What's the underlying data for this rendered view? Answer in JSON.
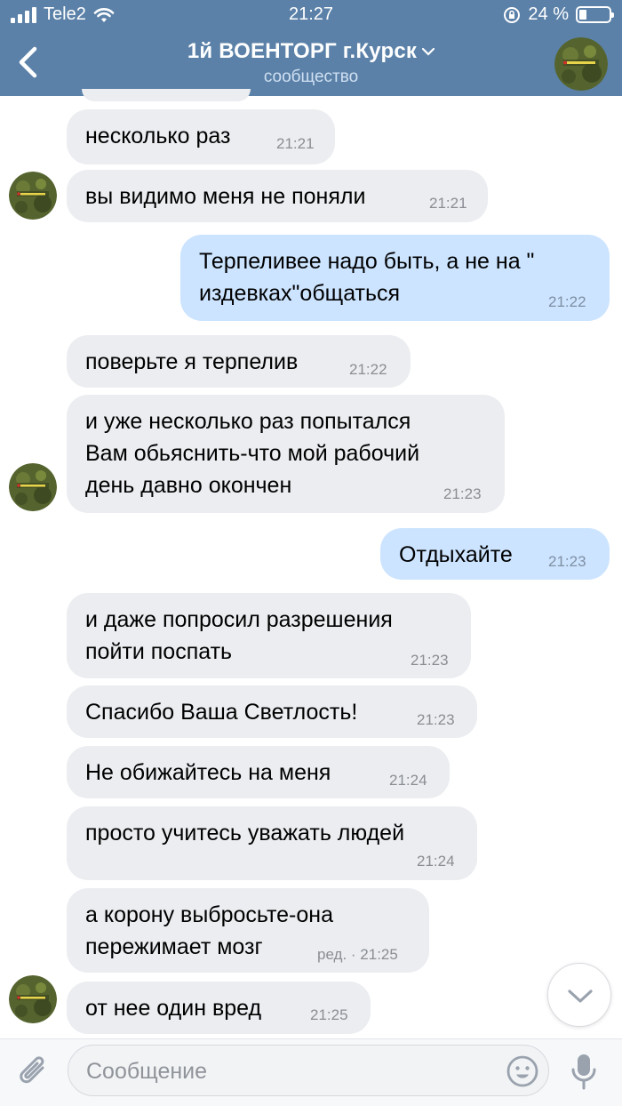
{
  "status_bar": {
    "carrier": "Tele2",
    "time": "21:27",
    "battery_text": "24 %",
    "battery_level": 0.24
  },
  "header": {
    "title": "1й ВОЕНТОРГ г.Курск",
    "subtitle": "сообщество"
  },
  "messages": [
    {
      "text": "несколько раз",
      "time": "21:21"
    },
    {
      "text": "вы видимо меня не поняли",
      "time": "21:21"
    },
    {
      "text": "Терпеливее надо быть, а не на \"\nиздевках\"общаться",
      "time": "21:22"
    },
    {
      "text": "поверьте я терпелив",
      "time": "21:22"
    },
    {
      "text": "и уже несколько раз попытался\nВам обьяснить-что мой рабочий\nдень давно окончен",
      "time": "21:23"
    },
    {
      "text": "Отдыхайте",
      "time": "21:23"
    },
    {
      "text": "и даже попросил разрешения\nпойти поспать",
      "time": "21:23"
    },
    {
      "text": "Спасибо Ваша Светлость!",
      "time": "21:23"
    },
    {
      "text": "Не обижайтесь на меня",
      "time": "21:24"
    },
    {
      "text": "просто учитесь уважать людей",
      "time": "21:24"
    },
    {
      "text": "а корону выбросьте-она\nпережимает мозг",
      "time": "ред. · 21:25"
    },
    {
      "text": "от нее один вред",
      "time": "21:25"
    }
  ],
  "composer": {
    "placeholder": "Сообщение"
  },
  "icons": {
    "back": "chevron-left-icon",
    "attach": "paperclip-icon",
    "emoji": "smile-icon",
    "mic": "microphone-icon",
    "scroll_down": "chevron-down-icon"
  },
  "colors": {
    "header": "#5b81a8",
    "incoming_bubble": "#ebedf0",
    "outgoing_bubble": "#cce4ff"
  }
}
